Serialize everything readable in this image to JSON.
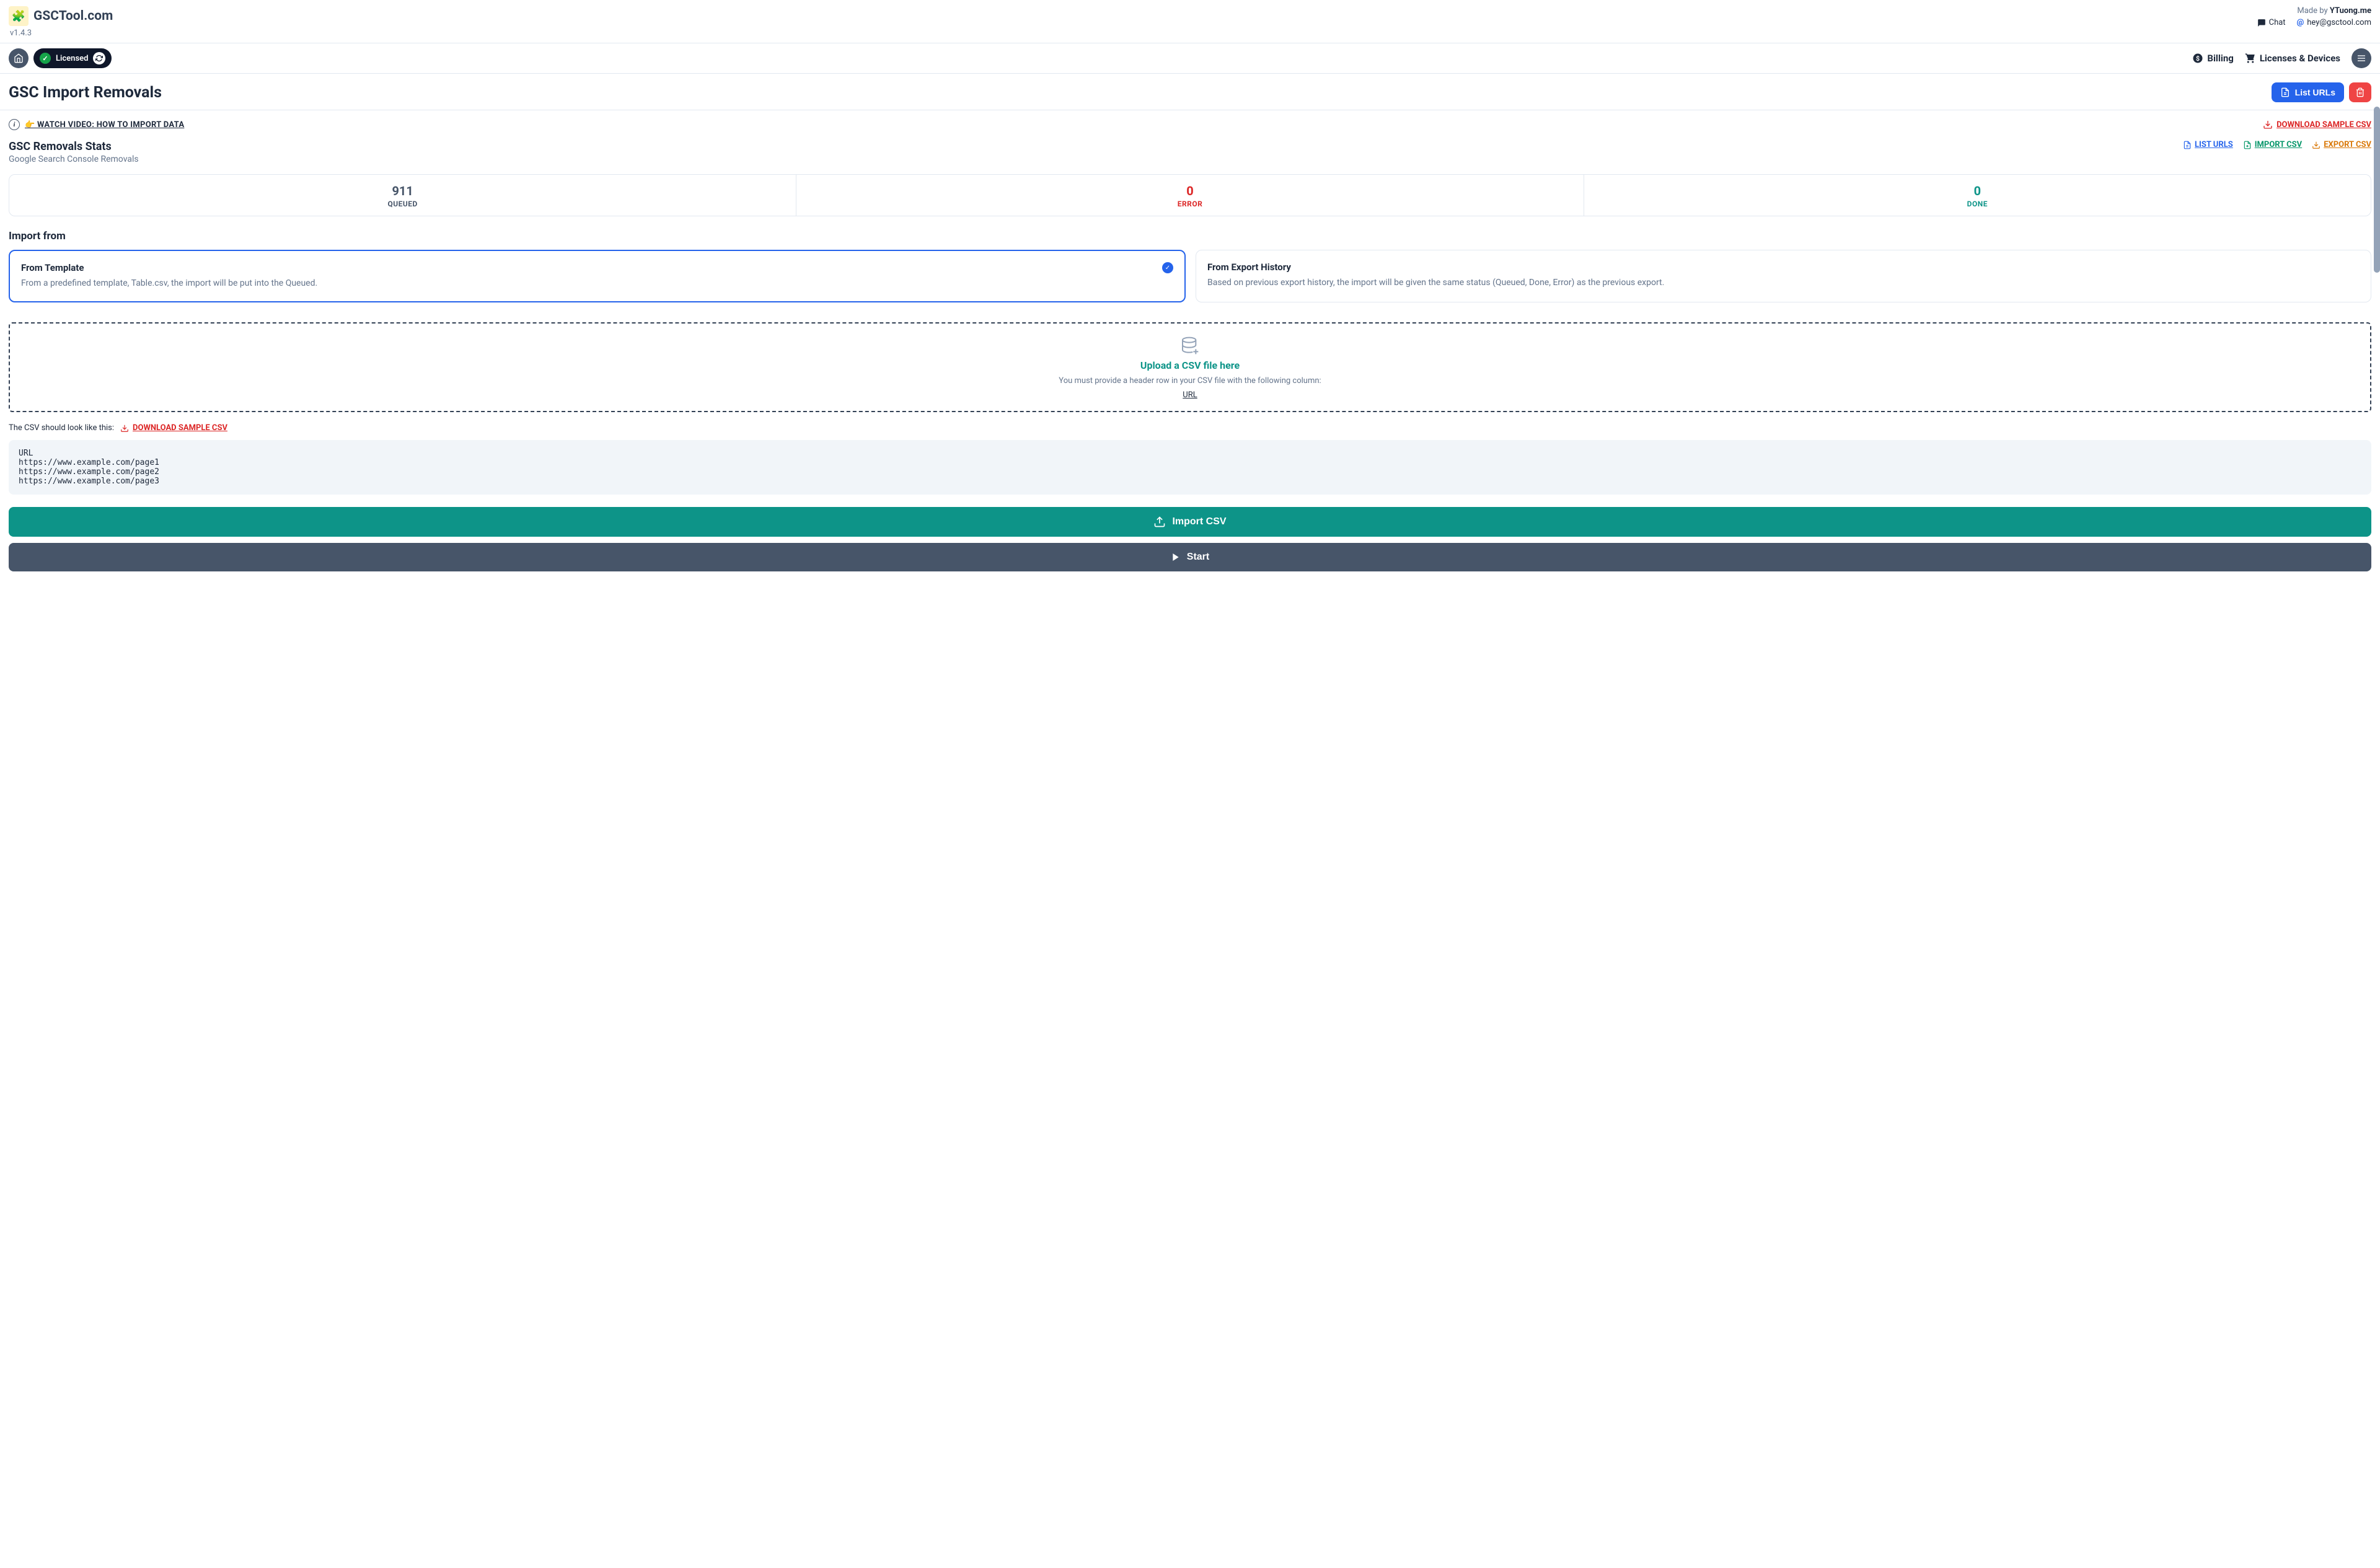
{
  "header": {
    "brand": "GSCTool.com",
    "version": "v1.4.3",
    "made_by_prefix": "Made by ",
    "made_by": "YTuong.me",
    "chat": "Chat",
    "email": "hey@gsctool.com"
  },
  "toolbar": {
    "licensed": "Licensed",
    "billing": "Billing",
    "licenses": "Licenses & Devices"
  },
  "page": {
    "title": "GSC Import Removals",
    "list_urls_btn": "List URLs",
    "watch_video": "WATCH VIDEO: HOW TO IMPORT DATA",
    "download_sample": "DOWNLOAD SAMPLE CSV"
  },
  "stats": {
    "title": "GSC Removals Stats",
    "subtitle": "Google Search Console Removals",
    "links": {
      "list_urls": "LIST URLS",
      "import_csv": "IMPORT CSV",
      "export_csv": "EXPORT CSV"
    },
    "cells": [
      {
        "value": "911",
        "label": "QUEUED"
      },
      {
        "value": "0",
        "label": "ERROR"
      },
      {
        "value": "0",
        "label": "DONE"
      }
    ]
  },
  "import": {
    "section_title": "Import from",
    "options": [
      {
        "title": "From Template",
        "desc": "From a predefined template, Table.csv, the import will be put into the Queued.",
        "selected": true
      },
      {
        "title": "From Export History",
        "desc": "Based on previous export history, the import will be given the same status (Queued, Done, Error) as the previous export.",
        "selected": false
      }
    ]
  },
  "dropzone": {
    "title": "Upload a CSV file here",
    "desc": "You must provide a header row in your CSV file with the following column:",
    "column": "URL"
  },
  "csv_example": {
    "prefix": "The CSV should look like this:",
    "download": "DOWNLOAD SAMPLE CSV",
    "code": "URL\nhttps://www.example.com/page1\nhttps://www.example.com/page2\nhttps://www.example.com/page3"
  },
  "actions": {
    "import_csv": "Import CSV",
    "start": "Start"
  }
}
